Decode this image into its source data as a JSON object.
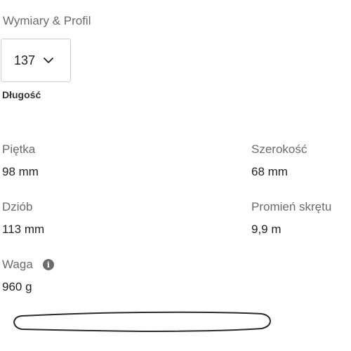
{
  "section": {
    "title": "Wymiary & Profil"
  },
  "length": {
    "selected": "137",
    "label": "Długość"
  },
  "specs": {
    "heel": {
      "label": "Piętka",
      "value": "98 mm"
    },
    "width": {
      "label": "Szerokość",
      "value": "68 mm"
    },
    "tip": {
      "label": "Dziób",
      "value": "113 mm"
    },
    "radius": {
      "label": "Promień skrętu",
      "value": "9,9 m"
    },
    "weight": {
      "label": "Waga",
      "value": "960 g",
      "info_icon": "info-icon"
    }
  }
}
